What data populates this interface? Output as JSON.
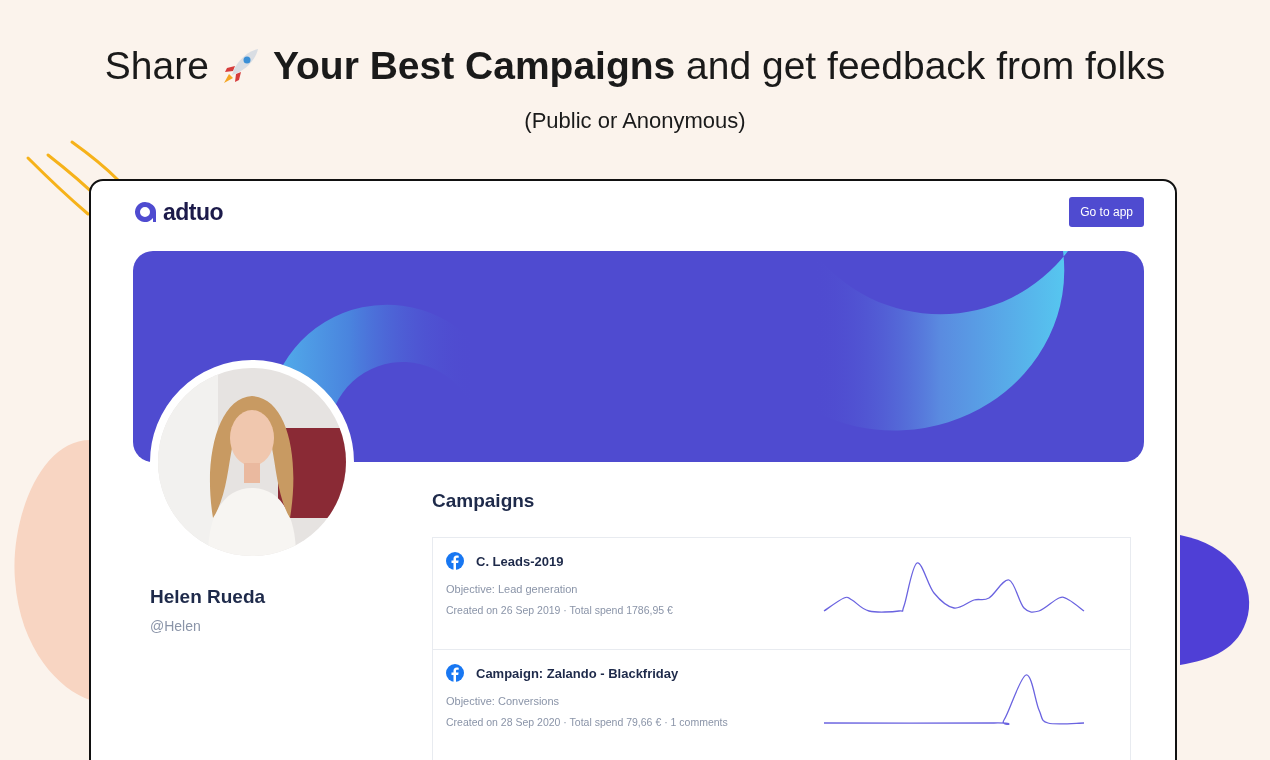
{
  "headline": {
    "lead": "Share",
    "rest": "**Your Best Campaigns** and get feedback from folks"
  },
  "subtitle": "(Public or Anonymous)",
  "app": {
    "logo": "adtuo",
    "button": "Go to app"
  },
  "profile": {
    "name": "Helen Rueda",
    "handle": "@Helen"
  },
  "campaigns": {
    "title": "Campaigns",
    "items": [
      {
        "name": "C. Leads-2019",
        "objective": "Objective: Lead generation",
        "meta": "Created on 26 Sep 2019 · Total spend 1786,95 €"
      },
      {
        "name": "Campaign: Zalando - Blackfriday",
        "objective": "Objective: Conversions",
        "meta": "Created on 28 Sep 2020 · Total spend 79,66 € · 1 comments"
      }
    ]
  }
}
